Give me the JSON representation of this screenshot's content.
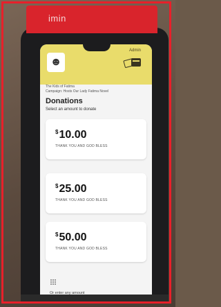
{
  "device": {
    "brand": "imin"
  },
  "header": {
    "admin_label": "Admin"
  },
  "org": {
    "name": "The Kids of Fatima",
    "campaign": "Campaign: Hosts Our Lady Fatima Novel"
  },
  "page": {
    "title": "Donations",
    "subtitle": "Select an amount to donate"
  },
  "amounts": [
    {
      "currency": "$",
      "value": "10.00",
      "thanks": "THANK YOU AND GOD BLESS"
    },
    {
      "currency": "$",
      "value": "25.00",
      "thanks": "THANK YOU AND GOD BLESS"
    },
    {
      "currency": "$",
      "value": "50.00",
      "thanks": "THANK YOU AND GOD BLESS"
    }
  ],
  "other_amount": {
    "label": "Or enter any amount"
  },
  "colors": {
    "frame": "#e8202a",
    "header": "#e9dc6b",
    "device_top": "#d9242c"
  }
}
